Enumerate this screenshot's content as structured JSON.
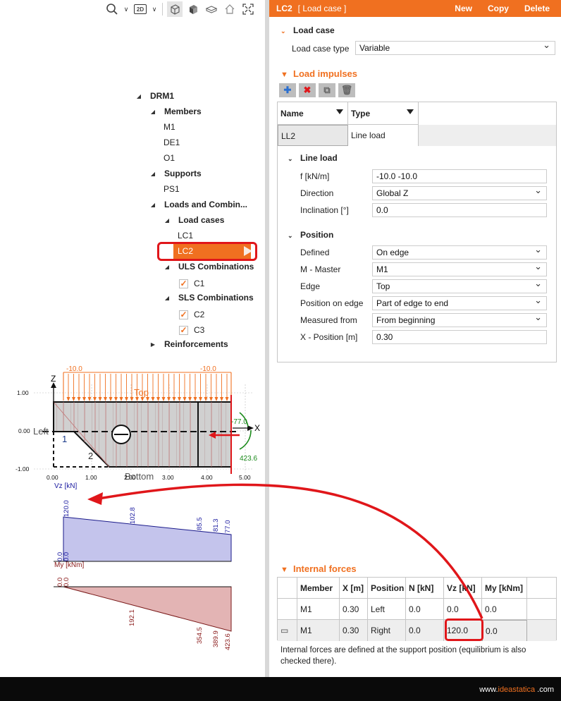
{
  "toolbar": {
    "icons": [
      "search-icon",
      "view-2d-icon",
      "wireframe-icon",
      "solid-icon",
      "model-icon",
      "home-icon",
      "fit-icon"
    ],
    "view_mode": "2D"
  },
  "tree": {
    "root": "DRM1",
    "members_label": "Members",
    "members": [
      "M1",
      "DE1",
      "O1"
    ],
    "supports_label": "Supports",
    "supports": [
      "PS1"
    ],
    "loads_label": "Loads and Combin...",
    "load_cases_label": "Load cases",
    "load_cases": [
      "LC1",
      "LC2"
    ],
    "selected": "LC2",
    "uls_label": "ULS Combinations",
    "uls": [
      "C1"
    ],
    "sls_label": "SLS Combinations",
    "sls": [
      "C2",
      "C3"
    ],
    "reinf_label": "Reinforcements"
  },
  "scene": {
    "load_left": "-10.0",
    "load_right": "-10.0",
    "top_label": "Top",
    "bottom_label": "Bottom",
    "left_label": "Left",
    "z_label": "Z",
    "x_label": "X",
    "moment_top": "-77.0",
    "moment_bottom": "423.6",
    "node1": "1",
    "node2": "2",
    "y_ticks": [
      "1.00",
      "0.00",
      "-1.00"
    ],
    "x_ticks": [
      "0.00",
      "1.00",
      "2.00",
      "3.00",
      "4.00",
      "5.00"
    ]
  },
  "diagrams": {
    "vz_title": "Vz [kN]",
    "vz_values": [
      "120.0",
      "102.8",
      "85.5",
      "81.3",
      "77.0"
    ],
    "vz_zero": [
      "0.0",
      "0.0"
    ],
    "my_title": "My [kNm]",
    "my_zero": [
      "0.0",
      "0.0"
    ],
    "my_values": [
      "192.1",
      "354.5",
      "389.9",
      "423.6"
    ]
  },
  "header": {
    "title": "LC2",
    "subtitle": "[ Load case ]",
    "new": "New",
    "copy": "Copy",
    "delete": "Delete"
  },
  "load_case": {
    "section": "Load case",
    "type_label": "Load case type",
    "type_value": "Variable"
  },
  "impulses": {
    "section": "Load impulses",
    "col_name": "Name",
    "col_type": "Type",
    "row_name": "LL2",
    "row_type": "Line load"
  },
  "line_load": {
    "section": "Line load",
    "f_label": "f [kN/m]",
    "f_value": "-10.0 -10.0",
    "dir_label": "Direction",
    "dir_value": "Global Z",
    "incl_label": "Inclination [°]",
    "incl_value": "0.0"
  },
  "position": {
    "section": "Position",
    "defined_label": "Defined",
    "defined_value": "On edge",
    "master_label": "M - Master",
    "master_value": "M1",
    "edge_label": "Edge",
    "edge_value": "Top",
    "pos_label": "Position on edge",
    "pos_value": "Part of edge to end",
    "meas_label": "Measured from",
    "meas_value": "From beginning",
    "x_label": "X - Position [m]",
    "x_value": "0.30"
  },
  "internal_forces": {
    "section": "Internal forces",
    "headers": [
      "Member",
      "X [m]",
      "Position",
      "N [kN]",
      "Vz [kN]",
      "My [kNm]"
    ],
    "rows": [
      [
        "M1",
        "0.30",
        "Left",
        "0.0",
        "0.0",
        "0.0"
      ],
      [
        "M1",
        "0.30",
        "Right",
        "0.0",
        "120.0",
        "0.0"
      ]
    ],
    "note": "Internal forces are defined at the support position (equilibrium is also checked there)."
  },
  "footer": {
    "url_prefix": "www.",
    "url_brand": "ideastatica",
    "url_suffix": " .com"
  },
  "colors": {
    "accent": "#f07020",
    "highlight": "#e0161a",
    "vz_fill": "#c4c4ec",
    "my_fill": "#e3b4b4"
  }
}
